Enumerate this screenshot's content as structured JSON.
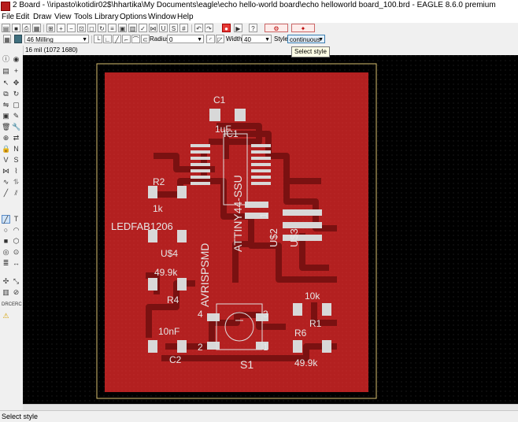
{
  "window": {
    "title": "2 Board - \\\\ripasto\\kotidir02$\\hhartika\\My Documents\\eagle\\echo hello-world board\\echo helloworld board_100.brd - EAGLE 8.6.0 premium"
  },
  "menu": [
    "File",
    "Edit",
    "Draw",
    "View",
    "Tools",
    "Library",
    "Options",
    "Window",
    "Help"
  ],
  "toolbar2": {
    "layer": "46 Milling",
    "radius_label": "Radius:",
    "radius_value": "0",
    "width_label": "Width:",
    "width_value": "40",
    "style_label": "Style:",
    "style_value": "continuous"
  },
  "tooltip": "Select style",
  "coord": "16 mil (1072 1680)",
  "status": "Select style",
  "board": {
    "labels": {
      "c1": "C1",
      "c1_value": "1uF",
      "ic1": "IC1",
      "ic1_value": "ATTINY44-SSU",
      "pin1": "1",
      "r2": "R2",
      "r2_value": "1k",
      "led": "LEDFAB1206",
      "u4": "U$4",
      "u2": "U$2",
      "u3": "U$3",
      "avr": "AVRISPSMD",
      "r4_value": "49.9k",
      "r4": "R4",
      "r1_value": "10k",
      "r1": "R1",
      "c2_value": "10nF",
      "c2": "C2",
      "r6": "R6",
      "r6_value": "49.9k",
      "s1": "S1",
      "sw1": "1",
      "sw2": "2",
      "sw3": "3",
      "sw4": "4"
    }
  },
  "colors": {
    "board": "#b32020",
    "copper": "#7a1111",
    "pad": "#d8d8d8",
    "background": "#000000"
  },
  "icons": [
    "grid-icon",
    "layer-color-icon",
    "undo-icon",
    "redo-icon",
    "stop-icon",
    "help-icon",
    "info-icon",
    "move-icon",
    "copy-icon",
    "wire-icon",
    "text-icon",
    "circle-icon",
    "drc-icon",
    "erc-icon",
    "warning-icon"
  ]
}
